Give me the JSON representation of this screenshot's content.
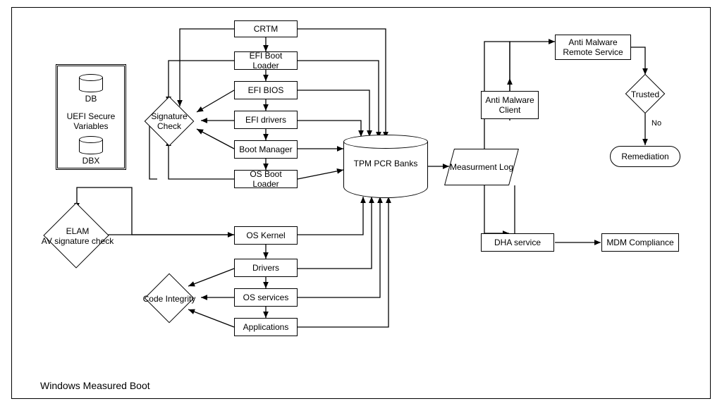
{
  "title": "Windows Measured Boot",
  "uefi": {
    "group": "UEFI Secure Variables",
    "db": "DB",
    "dbx": "DBX"
  },
  "chain": {
    "crtm": "CRTM",
    "efi_boot_loader": "EFI Boot Loader",
    "efi_bios": "EFI BIOS",
    "efi_drivers": "EFI drivers",
    "boot_manager": "Boot Manager",
    "os_boot_loader": "OS Boot Loader",
    "os_kernel": "OS Kernel",
    "drivers": "Drivers",
    "os_services": "OS services",
    "applications": "Applications"
  },
  "checks": {
    "signature": "Signature Check",
    "elam": "ELAM\nAV signature check",
    "code_integrity": "Code Integrity"
  },
  "tpm": {
    "banks": "TPM PCR Banks",
    "log": "Measurment Log"
  },
  "right": {
    "am_client": "Anti Malware Client",
    "am_remote": "Anti Malware Remote Service",
    "trusted": "Trusted",
    "no": "No",
    "remediation": "Remediation",
    "dha": "DHA service",
    "mdm": "MDM Compliance"
  }
}
